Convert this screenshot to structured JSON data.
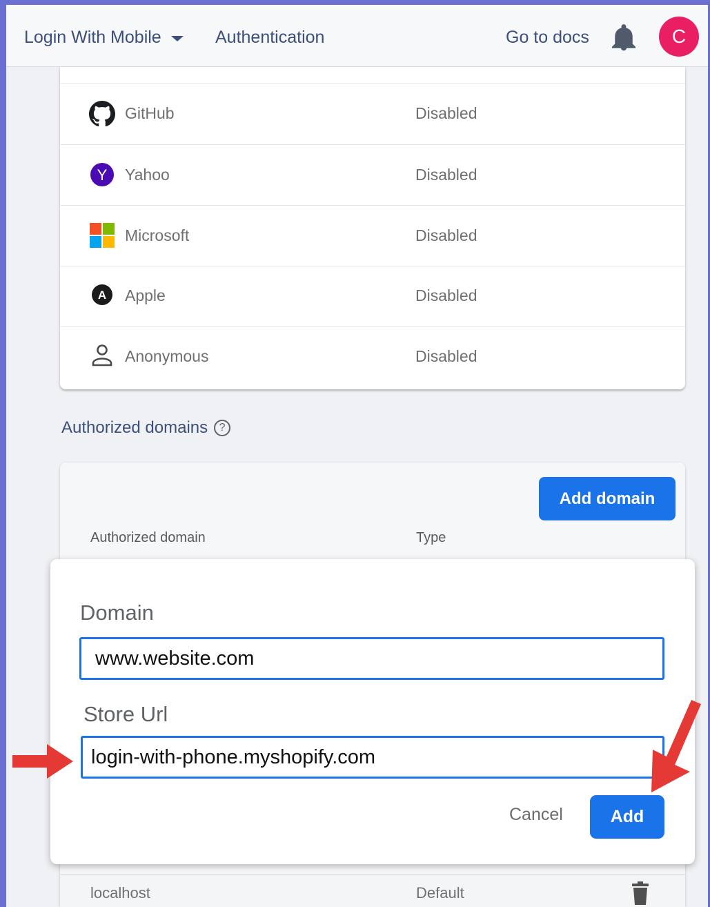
{
  "topbar": {
    "project_name": "Login With Mobile",
    "section": "Authentication",
    "docs_link": "Go to docs",
    "avatar_initial": "C",
    "avatar_color": "#e91e63"
  },
  "providers": [
    {
      "name": "GitHub",
      "status": "Disabled",
      "icon": "github-icon"
    },
    {
      "name": "Yahoo",
      "status": "Disabled",
      "icon": "yahoo-icon"
    },
    {
      "name": "Microsoft",
      "status": "Disabled",
      "icon": "microsoft-icon"
    },
    {
      "name": "Apple",
      "status": "Disabled",
      "icon": "apple-icon"
    },
    {
      "name": "Anonymous",
      "status": "Disabled",
      "icon": "person-outline-icon"
    }
  ],
  "authorized_domains": {
    "title": "Authorized domains",
    "add_button": "Add domain",
    "columns": {
      "domain": "Authorized domain",
      "type": "Type"
    },
    "rows": [
      {
        "domain": "localhost",
        "type": "Default"
      }
    ]
  },
  "dialog": {
    "domain_label": "Domain",
    "domain_value": "www.website.com",
    "store_url_label": "Store Url",
    "store_url_value": "login-with-phone.myshopify.com",
    "cancel_label": "Cancel",
    "add_label": "Add"
  },
  "colors": {
    "accent": "#1a73e8",
    "annotation_arrow": "#e53935",
    "screenshot_border": "#6a6fd2"
  }
}
